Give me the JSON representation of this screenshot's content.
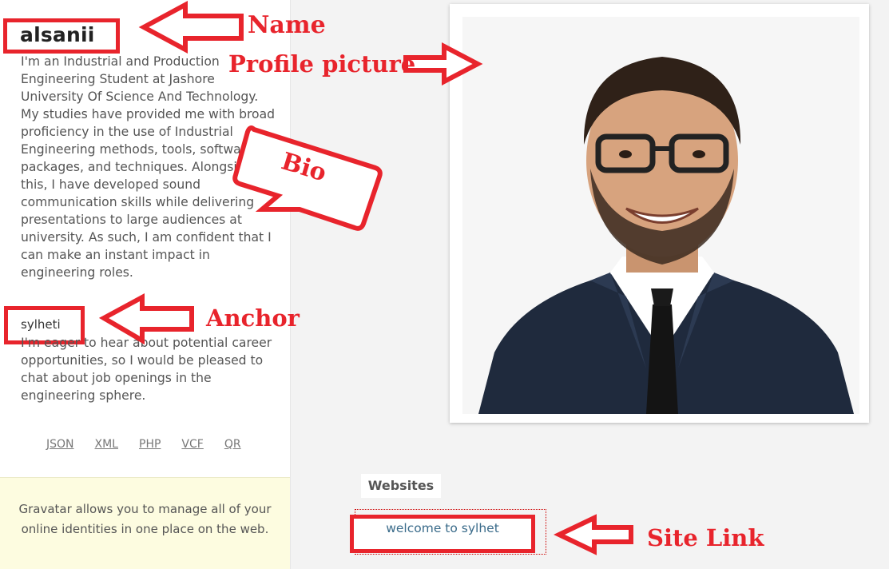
{
  "profile": {
    "name": "alsanii",
    "bio_part1": "I'm an Industrial and Production Engineering Student at Jashore University Of Science And Technology. My studies have provided me with broad proficiency in the use of Industrial Engineering methods, tools, software packages, and techniques. Alongside this, I have developed sound communication skills while delivering presentations to large audiences at university. As such, I am confident that I can make an instant impact in engineering roles.",
    "anchor": "sylheti",
    "bio_part2": "I'm eager to hear about potential career opportunities, so I would be pleased to chat about job openings in the engineering sphere."
  },
  "formats": [
    "JSON",
    "XML",
    "PHP",
    "VCF",
    "QR"
  ],
  "gravatar_note": "Gravatar allows you to manage all of your online identities in one place on the web.",
  "websites": {
    "title": "Websites",
    "link_text": "welcome to sylhet"
  },
  "annotations": {
    "name": "Name",
    "profile_picture": "Profile picture",
    "bio": "Bio",
    "anchor": "Anchor",
    "site_link": "Site Link"
  },
  "colors": {
    "annotation_red": "#e8242c",
    "link_blue": "#3a6b8a",
    "note_bg": "#fdfce0"
  },
  "icons": [
    "avatar-photo",
    "arrow-left-icon",
    "arrow-right-icon",
    "speech-bubble-icon"
  ]
}
